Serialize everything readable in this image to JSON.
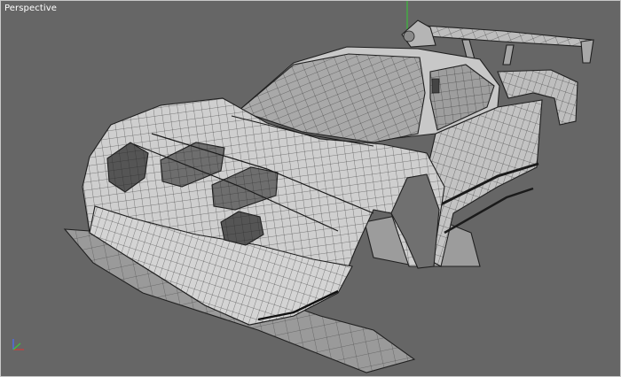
{
  "viewport": {
    "label": "Perspective",
    "background": "#666666",
    "border": "#c8c8c8",
    "model_surface": "#c9c9c9",
    "wire_color": "#1e1e1e"
  },
  "axis_gizmo": {
    "icon": "xyz-axis-gizmo-icon",
    "x_color": "#d23c3c",
    "y_color": "#3cc83c",
    "z_color": "#4a6cff"
  }
}
